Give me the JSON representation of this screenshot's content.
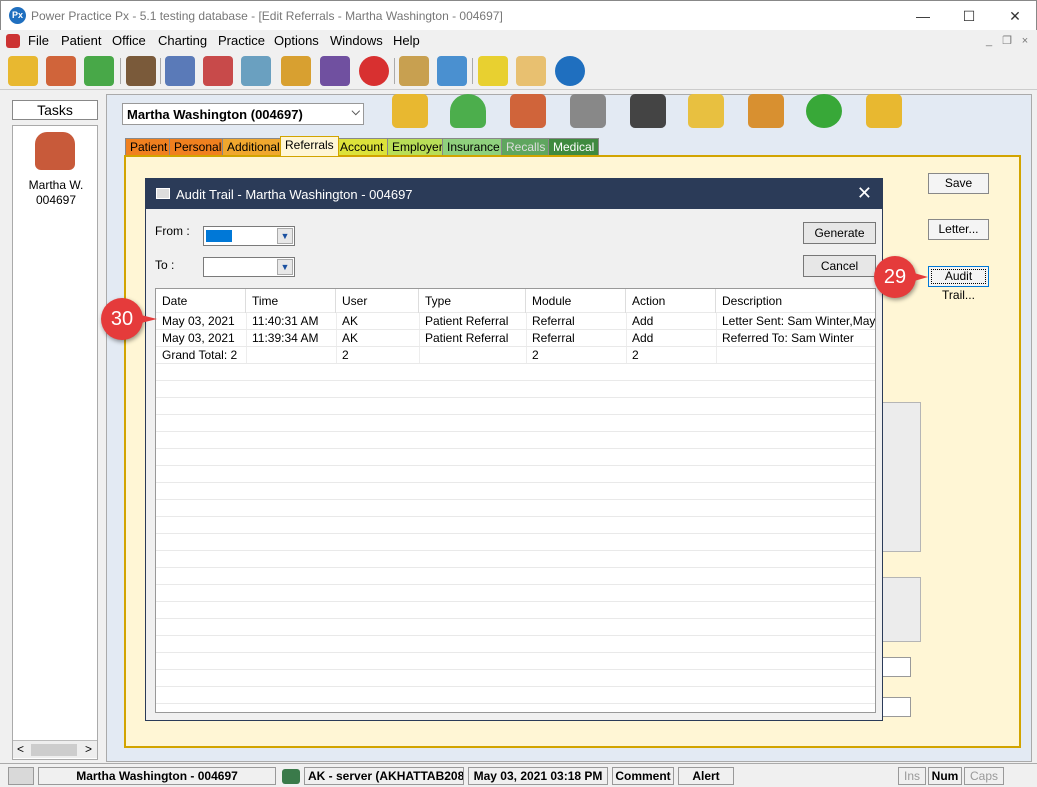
{
  "window": {
    "app_icon_text": "Px",
    "title": "Power Practice Px - 5.1 testing database - [Edit Referrals - Martha Washington - 004697]",
    "min": "—",
    "max": "☐",
    "close": "✕"
  },
  "menu": [
    {
      "label": "File"
    },
    {
      "label": "Patient"
    },
    {
      "label": "Office"
    },
    {
      "label": "Charting"
    },
    {
      "label": "Practice"
    },
    {
      "label": "Options"
    },
    {
      "label": "Windows"
    },
    {
      "label": "Help"
    }
  ],
  "mdi": {
    "min": "_",
    "restore": "❐",
    "close": "×"
  },
  "tasks": {
    "title": "Tasks",
    "patient_name": "Martha W.",
    "patient_id": "004697"
  },
  "patient_selector": {
    "value": "Martha Washington (004697)",
    "arrow": "⌵"
  },
  "tabs": [
    {
      "label": "Patient",
      "color": "#f0801f"
    },
    {
      "label": "Personal",
      "color": "#f0801f"
    },
    {
      "label": "Additional",
      "color": "#f0a72e"
    },
    {
      "label": "Referrals",
      "color": "#fff6d5"
    },
    {
      "label": "Account",
      "color": "#dce23a"
    },
    {
      "label": "Employer",
      "color": "#b8de57"
    },
    {
      "label": "Insurance",
      "color": "#8fd17d"
    },
    {
      "label": "Recalls",
      "color": "#5fa65f"
    },
    {
      "label": "Medical",
      "color": "#3f8a3f"
    }
  ],
  "right_buttons": {
    "save": "Save",
    "letter": "Letter...",
    "audit": "Audit Trail..."
  },
  "dialog": {
    "title": "Audit Trail - Martha Washington - 004697",
    "close": "✕",
    "from_label": "From :",
    "to_label": "To :",
    "arrow": "▼",
    "generate": "Generate",
    "cancel": "Cancel",
    "columns": [
      "Date",
      "Time",
      "User",
      "Type",
      "Module",
      "Action",
      "Description"
    ],
    "rows": [
      [
        "May 03, 2021",
        "11:40:31 AM",
        "AK",
        "Patient Referral",
        "Referral",
        "Add",
        "Letter Sent: Sam Winter,May..."
      ],
      [
        "May 03, 2021",
        "11:39:34 AM",
        "AK",
        "Patient Referral",
        "Referral",
        "Add",
        "Referred To: Sam Winter"
      ],
      [
        "Grand Total: 2",
        "",
        "2",
        "",
        "2",
        "2",
        ""
      ]
    ]
  },
  "callouts": {
    "c29": "29",
    "c30": "30"
  },
  "status": {
    "patient": "Martha Washington - 004697",
    "user": "AK - server (AKHATTAB208",
    "datetime": "May 03, 2021 03:18 PM",
    "comment": "Comment",
    "alert": "Alert",
    "ins": "Ins",
    "num": "Num",
    "caps": "Caps"
  },
  "scroll": {
    "left": "<",
    "right": ">"
  },
  "colors": {
    "title_bar": "#2b3b58",
    "panel": "#fff6d5",
    "panel_border": "#d2a400",
    "callout": "#e53b3b"
  }
}
